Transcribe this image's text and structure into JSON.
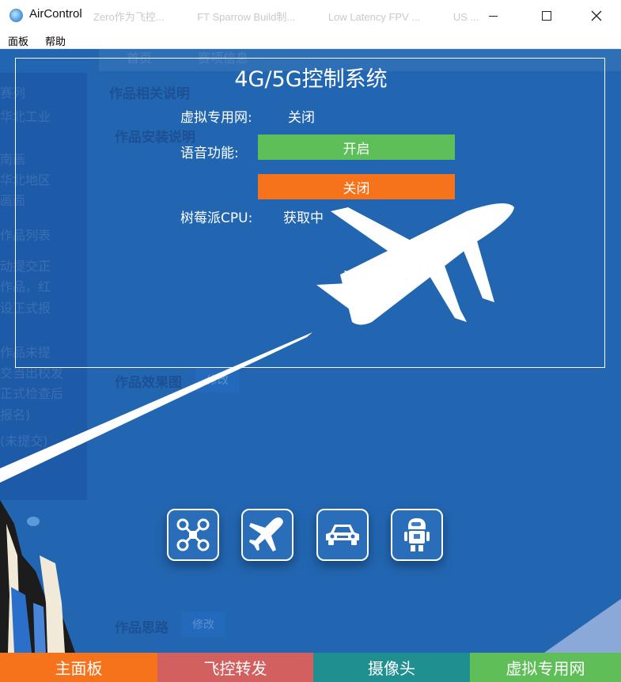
{
  "window": {
    "title": "AirControl",
    "ghost_tabs": [
      "Zero作为飞控...",
      "FT Sparrow Build制...",
      "Low Latency FPV ...",
      "US ..."
    ]
  },
  "menu": {
    "items": [
      "面板",
      "帮助"
    ]
  },
  "background_ghost": {
    "tabs": [
      "首页",
      "赛项信息"
    ],
    "heading": "作品相关说明",
    "install_label": "作品安装说明",
    "effect_label": "作品效果图",
    "idea_label": "作品思路",
    "edit_label": "修改",
    "sidebar_lines": [
      "赛列",
      "华北工业",
      "南画",
      "华北地区",
      "画面",
      "作品列表",
      "动提交正",
      "作品，红",
      "设正式报",
      "作品未提",
      "交当出校发",
      "正式检查后",
      "报名)",
      "(未提交)"
    ]
  },
  "panel": {
    "title": "4G/5G控制系统",
    "vpn_label": "虚拟专用网:",
    "vpn_value": "关闭",
    "voice_label": "语音功能:",
    "voice_on_button": "开启",
    "voice_off_button": "关闭",
    "cpu_label": "树莓派CPU:",
    "cpu_value": "获取中"
  },
  "modes": [
    {
      "name": "drone",
      "icon": "drone-icon"
    },
    {
      "name": "airplane",
      "icon": "airplane-icon"
    },
    {
      "name": "car",
      "icon": "car-icon"
    },
    {
      "name": "robot",
      "icon": "robot-icon"
    }
  ],
  "tabs": [
    "主面板",
    "飞控转发",
    "摄像头",
    "虚拟专用网"
  ],
  "colors": {
    "background": "#2266b2",
    "orange": "#f6731b",
    "green": "#5cbf58",
    "red": "#d2605f",
    "teal": "#1f8f8f"
  }
}
